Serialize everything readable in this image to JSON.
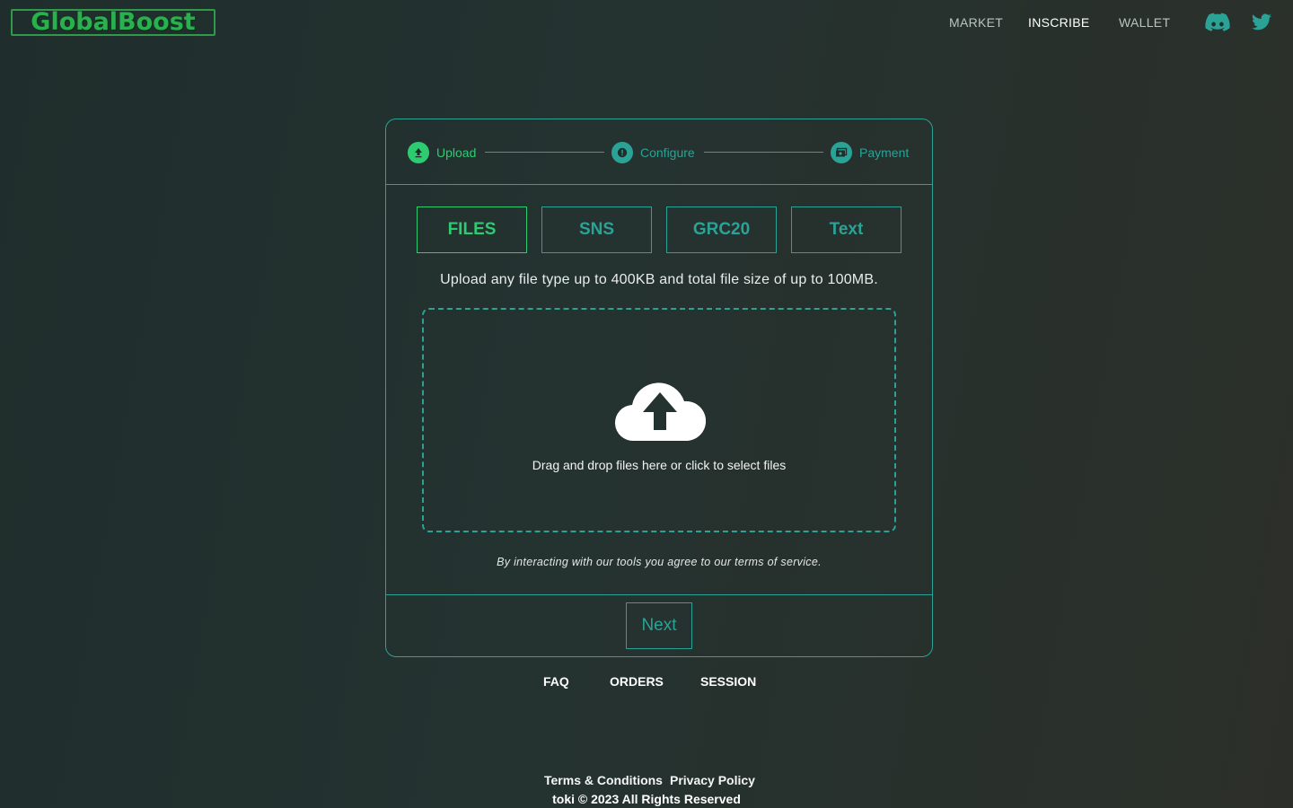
{
  "header": {
    "logo_text": "GlobalBoost",
    "nav": {
      "market": "MARKET",
      "inscribe": "INSCRIBE",
      "wallet": "WALLET"
    },
    "social": [
      "discord-icon",
      "twitter-icon"
    ]
  },
  "stepper": {
    "steps": [
      {
        "label": "Upload",
        "icon": "upload-icon",
        "state": "active"
      },
      {
        "label": "Configure",
        "icon": "info-icon",
        "state": "pending"
      },
      {
        "label": "Payment",
        "icon": "payment-icon",
        "state": "pending"
      }
    ]
  },
  "tabs": [
    {
      "label": "FILES",
      "active": true
    },
    {
      "label": "SNS",
      "active": false
    },
    {
      "label": "GRC20",
      "active": false
    },
    {
      "label": "Text",
      "active": false
    }
  ],
  "upload": {
    "info": "Upload any file type up to 400KB and total file size of up to 100MB.",
    "dropzone_text": "Drag and drop files here or click to select files",
    "terms": "By interacting with our tools you agree to our terms of service."
  },
  "next_label": "Next",
  "sub_nav": {
    "faq": "FAQ",
    "orders": "ORDERS",
    "session": "SESSION"
  },
  "footer": {
    "terms": "Terms & Conditions",
    "privacy": "Privacy Policy",
    "copyright": "toki © 2023 All Rights Reserved"
  },
  "colors": {
    "accent": "#2aa396",
    "active_green": "#2ecc71",
    "logo_green": "#2ab04f",
    "background_start": "#1f2e2c",
    "background_end": "#2c2f29"
  }
}
